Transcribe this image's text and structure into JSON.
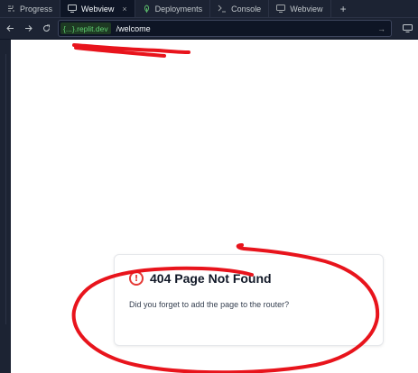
{
  "tabs": [
    {
      "label": "Progress",
      "icon": "progress-icon",
      "active": false
    },
    {
      "label": "Webview",
      "icon": "monitor-icon",
      "active": true,
      "close": "×"
    },
    {
      "label": "Deployments",
      "icon": "deployments-icon",
      "active": false
    },
    {
      "label": "Console",
      "icon": "terminal-icon",
      "active": false
    },
    {
      "label": "Webview",
      "icon": "monitor-icon",
      "active": false
    }
  ],
  "tab_add_label": "+",
  "address": {
    "domain": "{...}.replit.dev",
    "path": "/welcome"
  },
  "page": {
    "error_title": "404 Page Not Found",
    "error_message": "Did you forget to add the page to the router?",
    "error_icon_glyph": "!"
  },
  "colors": {
    "accent_error": "#e53935",
    "domain_green": "#5fd071",
    "annotation_red": "#e8141c"
  }
}
